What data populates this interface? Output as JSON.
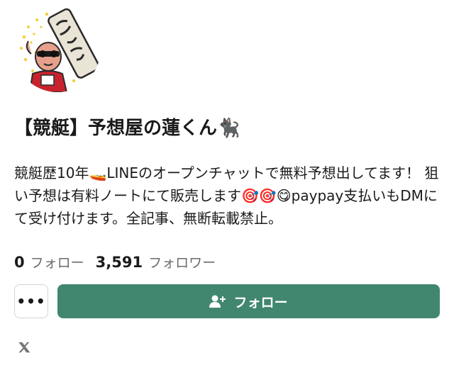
{
  "profile": {
    "name": "【競艇】予想屋の蓮くん🐈‍⬛",
    "bio": "競艇歴10年🚤LINEのオープンチャットで無料予想出してます！ 狙い予想は有料ノートにて販売します🎯🎯😋paypay支払いもDMにて受け付けます。全記事、無断転載禁止。",
    "avatar_icon": "avatar-icon"
  },
  "stats": {
    "following_count": "0",
    "following_label": "フォロー",
    "followers_count": "3,591",
    "followers_label": "フォロワー"
  },
  "actions": {
    "more_label": "•••",
    "follow_label": "フォロー",
    "follow_icon": "add-user-icon"
  },
  "social": {
    "x_icon": "x-icon"
  },
  "colors": {
    "accent": "#41876f",
    "muted_text": "#6b6b6b",
    "border": "#d4d4d4"
  }
}
